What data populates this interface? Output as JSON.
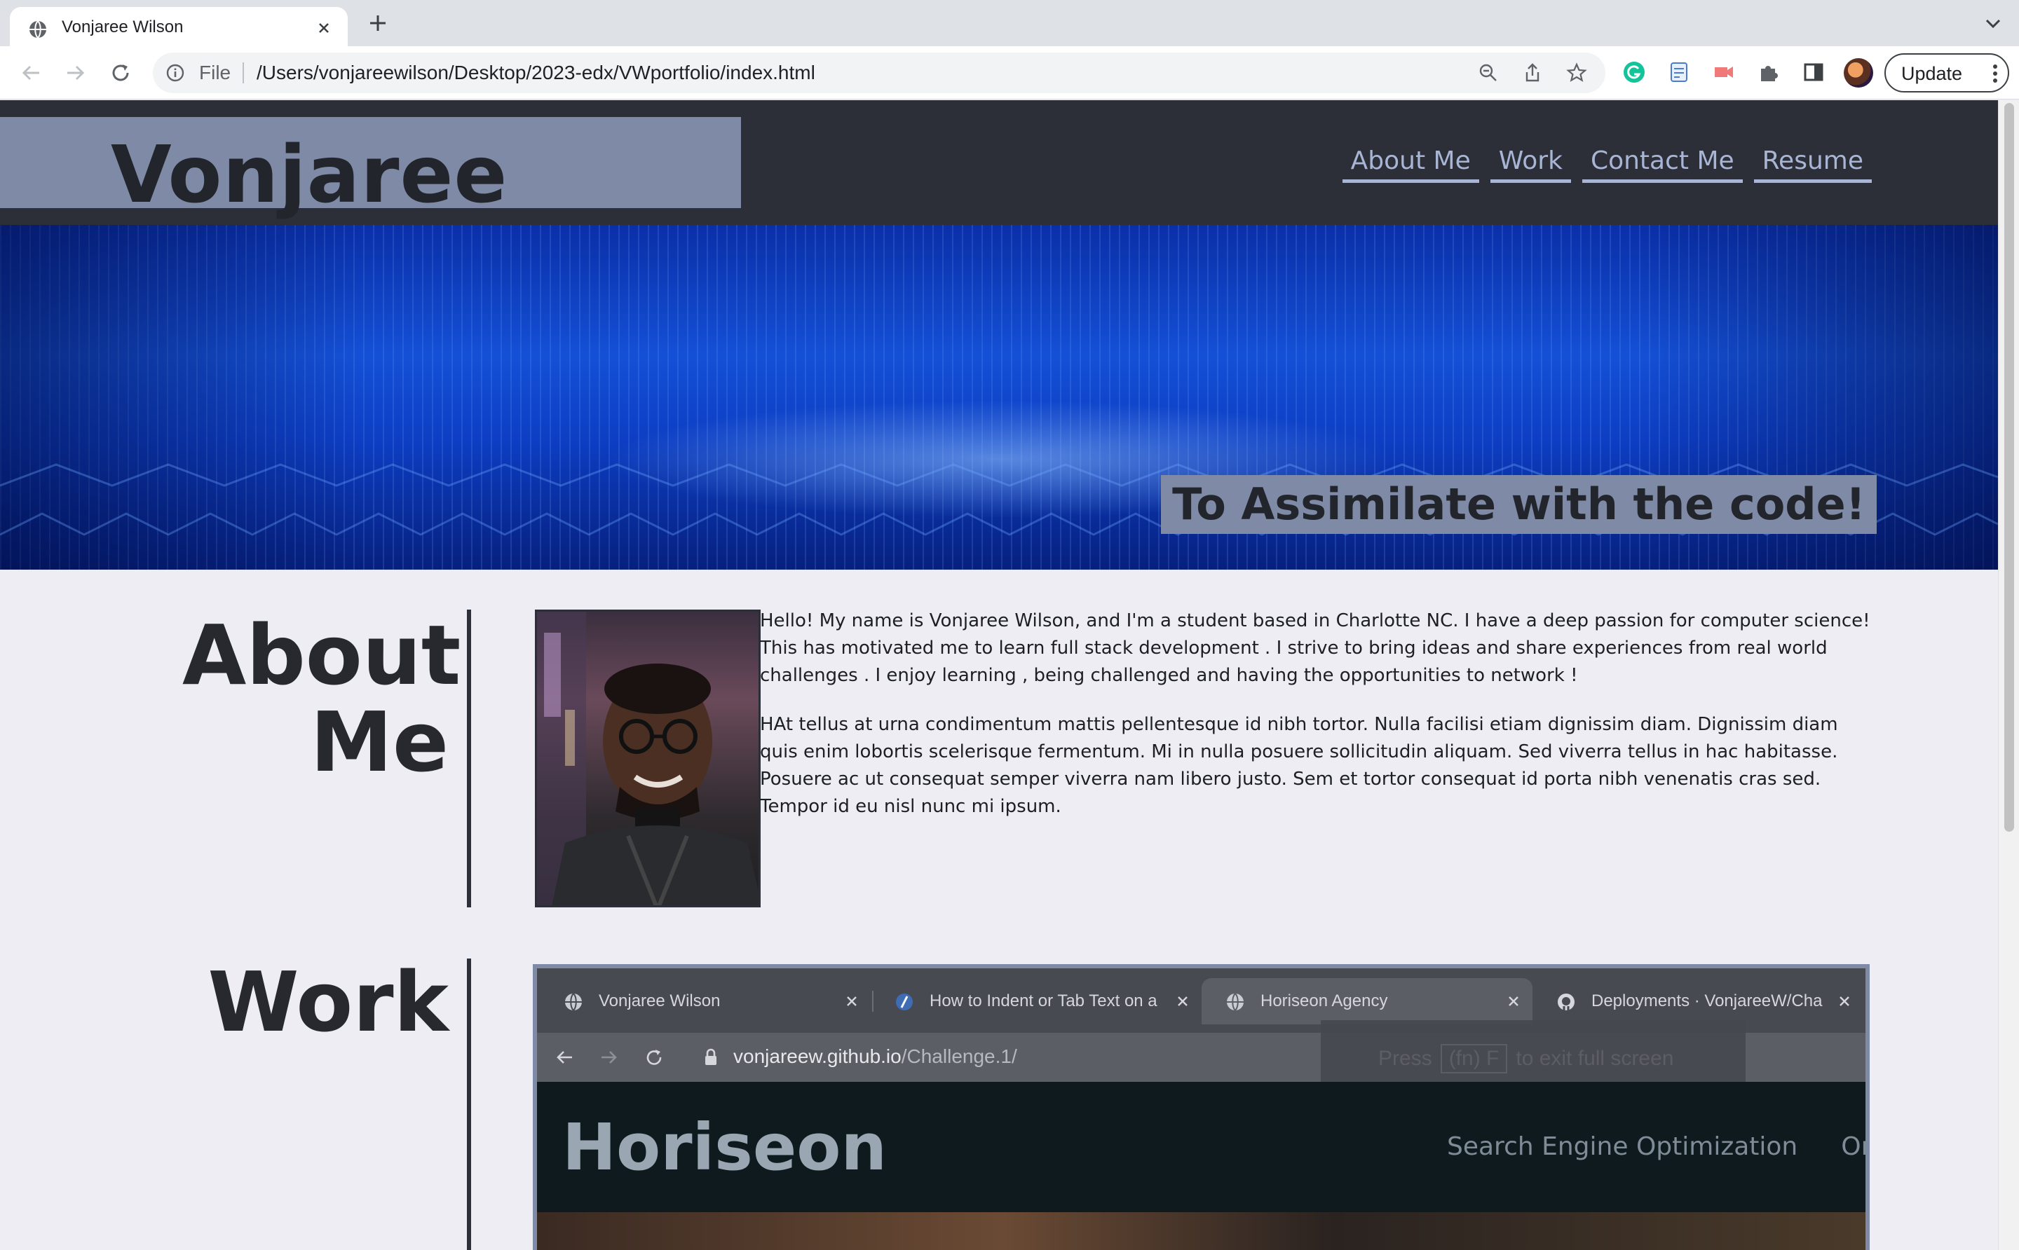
{
  "browser": {
    "tab_title": "Vonjaree Wilson",
    "omnibox_scheme": "File",
    "omnibox_url": "/Users/vonjareewilson/Desktop/2023-edx/VWportfolio/index.html",
    "update_label": "Update"
  },
  "site": {
    "title": "Vonjaree Wilson",
    "nav": [
      "About Me",
      "Work",
      "Contact Me",
      "Resume"
    ],
    "tagline": "To Assimilate with the code!"
  },
  "about": {
    "heading_line1": "About",
    "heading_line2": "Me",
    "paragraph1": "Hello! My name is Vonjaree Wilson, and I'm a student based in Charlotte NC. I have a deep passion for computer science! This has motivated me to learn full stack development . I strive to bring ideas and share experiences from real world challenges . I enjoy learning , being challenged and having the opportunities to network !",
    "paragraph2": "HAt tellus at urna condimentum mattis pellentesque id nibh tortor. Nulla facilisi etiam dignissim diam. Dignissim diam quis enim lobortis scelerisque fermentum. Mi in nulla posuere sollicitudin aliquam. Sed viverra tellus in hac habitasse. Posuere ac ut consequat semper viverra nam libero justo. Sem et tortor consequat id porta nibh venenatis cras sed. Tempor id eu nisl nunc mi ipsum."
  },
  "work": {
    "heading": "Work",
    "screenshot": {
      "tabs": [
        "Vonjaree Wilson",
        "How to Indent or Tab Text on a",
        "Horiseon Agency",
        "Deployments · VonjareeW/Cha"
      ],
      "url_host": "vonjareew.github.io",
      "url_path": "/Challenge.1/",
      "exit_fullscreen_pre": "Press",
      "exit_fullscreen_key": "(fn) F",
      "exit_fullscreen_post": "to exit full screen",
      "logo": "Horiseon",
      "nav": [
        "Search Engine Optimization",
        "Online"
      ]
    }
  },
  "colors": {
    "header_bg": "#2c2f38",
    "title_box": "#7e8aa6",
    "nav_link": "#a8b5d4",
    "page_bg": "#ededf3"
  }
}
